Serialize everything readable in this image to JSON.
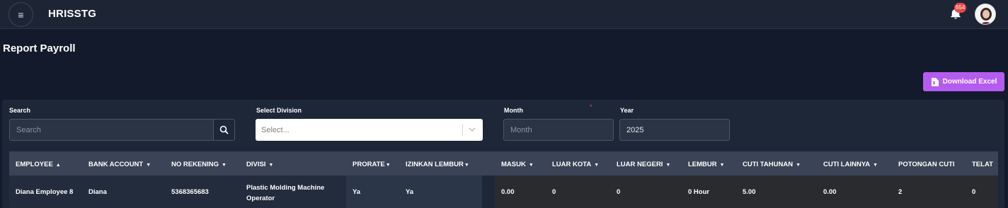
{
  "app": {
    "title": "HRISSTG",
    "notification_count": "654"
  },
  "page": {
    "title": "Report Payroll"
  },
  "actions": {
    "download_excel": "Download Excel"
  },
  "filters": {
    "search": {
      "label": "Search",
      "placeholder": "Search",
      "value": ""
    },
    "division": {
      "label": "Select Division",
      "placeholder": "Select..."
    },
    "month": {
      "label": "Month",
      "required_mark": "*",
      "placeholder": "Month"
    },
    "year": {
      "label": "Year",
      "value": "2025"
    }
  },
  "table": {
    "columns": [
      {
        "label": "EMPLOYEE",
        "sort": "▲"
      },
      {
        "label": "BANK ACCOUNT",
        "sort": "▼"
      },
      {
        "label": "NO REKENING",
        "sort": "▼"
      },
      {
        "label": "DIVISI",
        "sort": "▼"
      },
      {
        "label": "PRORATE",
        "sort": "▼"
      },
      {
        "label": "IZINKAN LEMBUR",
        "sort": "▼"
      },
      {
        "label": "MASUK",
        "sort": "▼"
      },
      {
        "label": "LUAR KOTA",
        "sort": "▼"
      },
      {
        "label": "LUAR NEGERI",
        "sort": "▼"
      },
      {
        "label": "LEMBUR",
        "sort": "▼"
      },
      {
        "label": "CUTI TAHUNAN",
        "sort": "▼"
      },
      {
        "label": "CUTI LAINNYA",
        "sort": "▼"
      },
      {
        "label": "POTONGAN CUTI",
        "sort": ""
      },
      {
        "label": "TELAT",
        "sort": ""
      }
    ],
    "rows": [
      {
        "employee": "Diana Employee 8",
        "bank_account": "Diana",
        "no_rekening": "5368365683",
        "divisi": "Plastic Molding Machine Operator",
        "prorate": "Ya",
        "izinkan_lembur": "Ya",
        "masuk": "0.00",
        "luar_kota": "0",
        "luar_negeri": "0",
        "lembur": "0 Hour",
        "cuti_tahunan": "5.00",
        "cuti_lainnya": "0.00",
        "potongan_cuti": "2",
        "telat": "0"
      }
    ]
  },
  "colors": {
    "accent": "#b55cf0",
    "badge": "#ef4444",
    "background": "#121a2b"
  },
  "icons": [
    "menu-icon",
    "bell-icon",
    "avatar",
    "excel-file-icon",
    "search-icon",
    "chevron-down-icon"
  ]
}
